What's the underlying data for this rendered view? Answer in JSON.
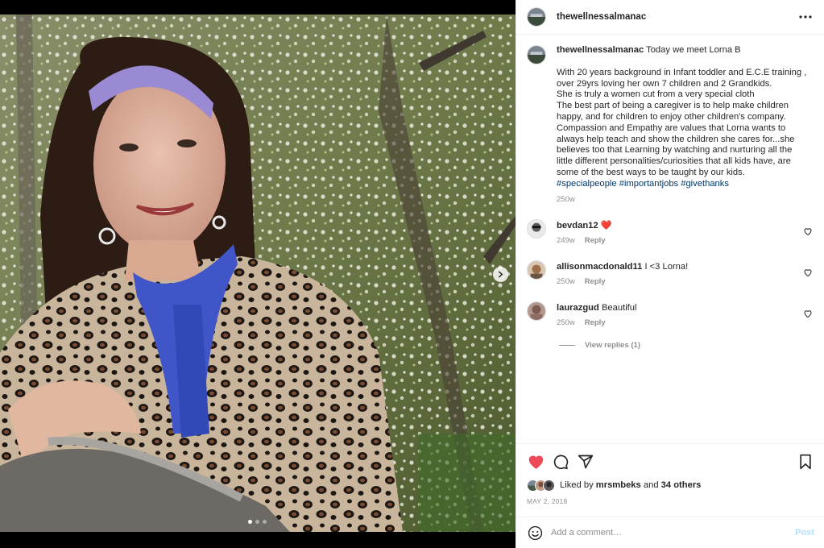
{
  "post": {
    "username": "thewellnessalmanac",
    "more_icon": "more-horizontal-icon",
    "carousel": {
      "total": 3,
      "current": 1
    }
  },
  "caption": {
    "username": "thewellnessalmanac",
    "first_line": "Today we meet Lorna B",
    "lines": [
      "With 20 years background in Infant toddler and E.C.E training ,",
      " over 29yrs loving her own 7 children and 2 Grandkids.",
      "She is truly a women cut from a very special cloth",
      "The best part of being a caregiver is to help make children",
      "happy, and for children to enjoy other children's company.",
      "Compassion and Empathy are values that Lorna wants to",
      "always help teach and show the children she cares for...she",
      "believes too that Learning by watching and nurturing all the",
      "little different personalities/curiosities that all kids have, are",
      "some of the best ways to be taught by our kids."
    ],
    "hashtags": "#specialpeople #importantjobs #givethanks",
    "time": "250w"
  },
  "comments": [
    {
      "username": "bevdan12",
      "text": "",
      "emoji": "❤️",
      "time": "249w",
      "reply_label": "Reply"
    },
    {
      "username": "allisonmacdonald11",
      "text": "I <3 Lorna!",
      "time": "250w",
      "reply_label": "Reply"
    },
    {
      "username": "laurazgud",
      "text": "Beautiful",
      "time": "250w",
      "reply_label": "Reply"
    }
  ],
  "view_replies": "View replies (1)",
  "likes": {
    "prefix": "Liked by ",
    "first_user": "mrsmbeks",
    "middle": " and ",
    "others": "34 others"
  },
  "date": "MAY 2, 2018",
  "add_comment": {
    "placeholder": "Add a comment…",
    "post_label": "Post"
  },
  "colors": {
    "like_red": "#ed4956",
    "link_blue": "#00376b",
    "post_disabled": "#b2dffc"
  }
}
